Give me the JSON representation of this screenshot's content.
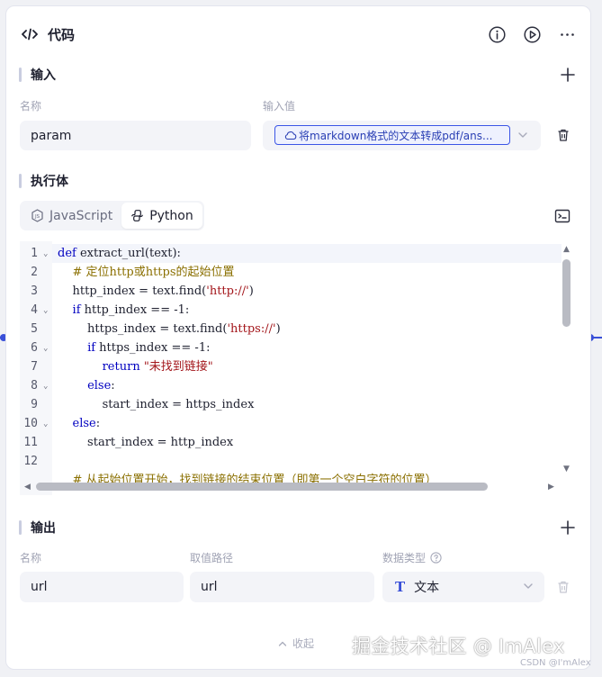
{
  "header": {
    "title": "代码",
    "buttons": [
      "info-icon",
      "run-icon",
      "more-icon"
    ]
  },
  "input_section": {
    "title": "输入",
    "col_name": "名称",
    "col_value": "输入值",
    "row": {
      "name": "param",
      "value_ref": "将markdown格式的文本转成pdf/ans..."
    }
  },
  "body_section": {
    "title": "执行体",
    "tabs": [
      {
        "label": "JavaScript",
        "active": false
      },
      {
        "label": "Python",
        "active": true
      }
    ]
  },
  "editor": {
    "line_numbers": [
      "1",
      "2",
      "3",
      "4",
      "5",
      "6",
      "7",
      "8",
      "9",
      "10",
      "11",
      "12"
    ],
    "fold_markers": [
      true,
      false,
      false,
      true,
      false,
      true,
      false,
      true,
      false,
      true,
      false,
      false
    ],
    "lines": [
      "def extract_url(text):",
      "    # 定位http或https的起始位置",
      "    http_index = text.find('http://')",
      "    if http_index == -1:",
      "        https_index = text.find('https://')",
      "        if https_index == -1:",
      "            return \"未找到链接\"",
      "        else:",
      "            start_index = https_index",
      "    else:",
      "        start_index = http_index",
      ""
    ],
    "partial_line": "    # 从起始位置开始，找到链接的结束位置（即第一个空白字符的位置）"
  },
  "output_section": {
    "title": "输出",
    "col_name": "名称",
    "col_path": "取值路径",
    "col_type": "数据类型",
    "row": {
      "name": "url",
      "path": "url",
      "type": "文本"
    }
  },
  "footer": {
    "collapse_label": "收起",
    "watermark": "掘金技术社区 @ ImAlex",
    "watermark_small": "CSDN @I'mAlex"
  },
  "colors": {
    "accent": "#3a50d8",
    "keyword": "#0000c0",
    "comment": "#8a6f00",
    "string": "#a3151a"
  }
}
